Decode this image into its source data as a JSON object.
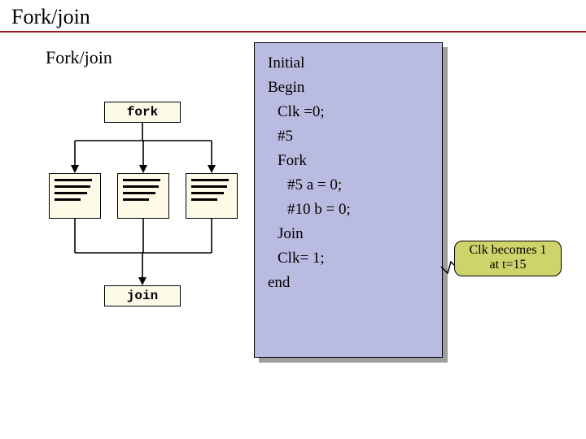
{
  "title": "Fork/join",
  "subtitle": "Fork/join",
  "diagram": {
    "fork_label": "fork",
    "join_label": "join"
  },
  "code": {
    "l1": "Initial",
    "l2": "Begin",
    "l3": "Clk =0;",
    "l4": "#5",
    "l5": "Fork",
    "l6": "#5 a  = 0;",
    "l7": "#10 b = 0;",
    "l8": "Join",
    "l9": "Clk= 1;",
    "l10": "end"
  },
  "annotation": {
    "line1": "Clk becomes 1",
    "line2": "at t=15"
  }
}
